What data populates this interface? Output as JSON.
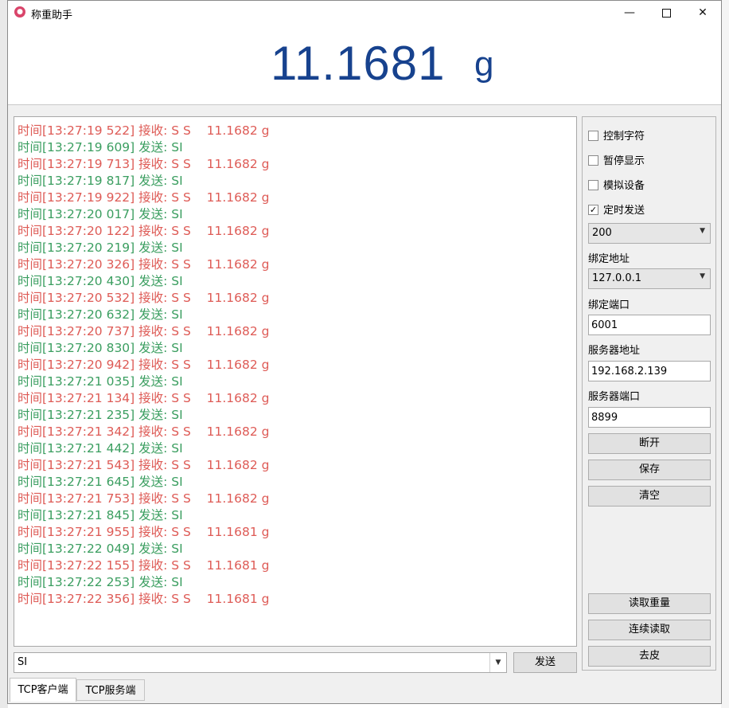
{
  "window": {
    "title": "称重助手",
    "minimize_glyph": "—",
    "close_glyph": "✕"
  },
  "weight": {
    "value": "11.1681",
    "unit": "g"
  },
  "log": [
    {
      "type": "recv",
      "text": "时间[13:27:19 522] 接收: S S    11.1682 g"
    },
    {
      "type": "send",
      "text": "时间[13:27:19 609] 发送: SI"
    },
    {
      "type": "recv",
      "text": "时间[13:27:19 713] 接收: S S    11.1682 g"
    },
    {
      "type": "send",
      "text": "时间[13:27:19 817] 发送: SI"
    },
    {
      "type": "recv",
      "text": "时间[13:27:19 922] 接收: S S    11.1682 g"
    },
    {
      "type": "send",
      "text": "时间[13:27:20 017] 发送: SI"
    },
    {
      "type": "recv",
      "text": "时间[13:27:20 122] 接收: S S    11.1682 g"
    },
    {
      "type": "send",
      "text": "时间[13:27:20 219] 发送: SI"
    },
    {
      "type": "recv",
      "text": "时间[13:27:20 326] 接收: S S    11.1682 g"
    },
    {
      "type": "send",
      "text": "时间[13:27:20 430] 发送: SI"
    },
    {
      "type": "recv",
      "text": "时间[13:27:20 532] 接收: S S    11.1682 g"
    },
    {
      "type": "send",
      "text": "时间[13:27:20 632] 发送: SI"
    },
    {
      "type": "recv",
      "text": "时间[13:27:20 737] 接收: S S    11.1682 g"
    },
    {
      "type": "send",
      "text": "时间[13:27:20 830] 发送: SI"
    },
    {
      "type": "recv",
      "text": "时间[13:27:20 942] 接收: S S    11.1682 g"
    },
    {
      "type": "send",
      "text": "时间[13:27:21 035] 发送: SI"
    },
    {
      "type": "recv",
      "text": "时间[13:27:21 134] 接收: S S    11.1682 g"
    },
    {
      "type": "send",
      "text": "时间[13:27:21 235] 发送: SI"
    },
    {
      "type": "recv",
      "text": "时间[13:27:21 342] 接收: S S    11.1682 g"
    },
    {
      "type": "send",
      "text": "时间[13:27:21 442] 发送: SI"
    },
    {
      "type": "recv",
      "text": "时间[13:27:21 543] 接收: S S    11.1682 g"
    },
    {
      "type": "send",
      "text": "时间[13:27:21 645] 发送: SI"
    },
    {
      "type": "recv",
      "text": "时间[13:27:21 753] 接收: S S    11.1682 g"
    },
    {
      "type": "send",
      "text": "时间[13:27:21 845] 发送: SI"
    },
    {
      "type": "recv",
      "text": "时间[13:27:21 955] 接收: S S    11.1681 g"
    },
    {
      "type": "send",
      "text": "时间[13:27:22 049] 发送: SI"
    },
    {
      "type": "recv",
      "text": "时间[13:27:22 155] 接收: S S    11.1681 g"
    },
    {
      "type": "send",
      "text": "时间[13:27:22 253] 发送: SI"
    },
    {
      "type": "recv",
      "text": "时间[13:27:22 356] 接收: S S    11.1681 g"
    }
  ],
  "command": {
    "value": "SI",
    "send_label": "发送"
  },
  "side": {
    "control_chars": "控制字符",
    "pause_display": "暂停显示",
    "simulate_device": "模拟设备",
    "timed_send": "定时发送",
    "timed_send_checked_glyph": "✓",
    "interval": "200",
    "bind_address_label": "绑定地址",
    "bind_address": "127.0.0.1",
    "bind_port_label": "绑定端口",
    "bind_port": "6001",
    "server_address_label": "服务器地址",
    "server_address": "192.168.2.139",
    "server_port_label": "服务器端口",
    "server_port": "8899",
    "disconnect": "断开",
    "save": "保存",
    "clear": "清空",
    "read_weight": "读取重量",
    "continuous_read": "连续读取",
    "tare": "去皮"
  },
  "tabs": {
    "tcp_client": "TCP客户端",
    "tcp_server": "TCP服务端"
  },
  "colors": {
    "recv": "#de5b56",
    "send": "#3b9e60",
    "weight": "#17428e"
  }
}
